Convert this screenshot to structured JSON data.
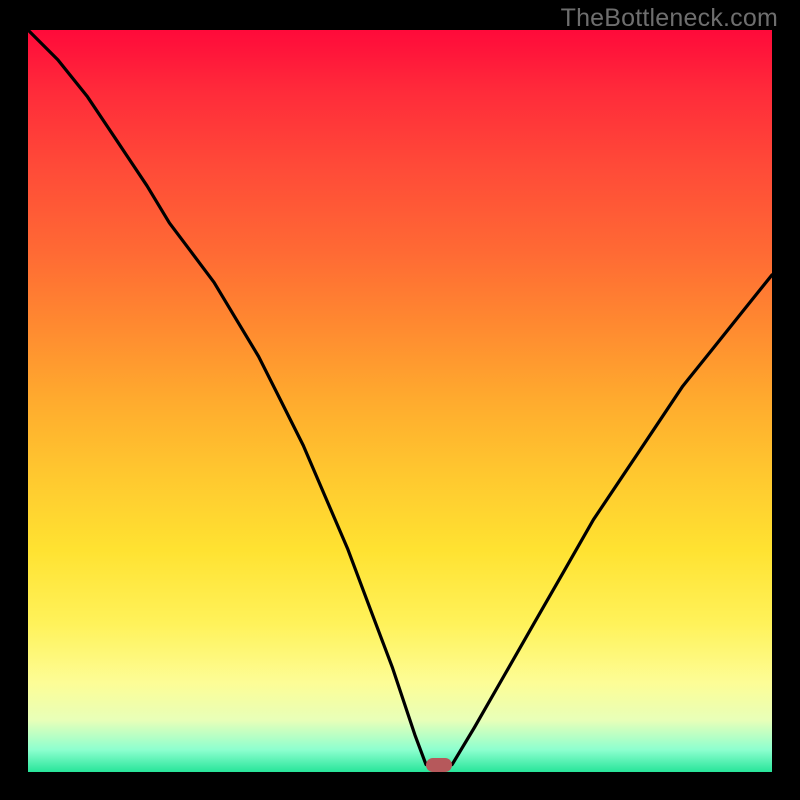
{
  "watermark": {
    "text": "TheBottleneck.com"
  },
  "marker": {
    "x_pct": 55.2,
    "y_pct": 99.05,
    "color": "#b6585b"
  },
  "chart_data": {
    "type": "line",
    "title": "",
    "xlabel": "",
    "ylabel": "",
    "xlim": [
      0,
      100
    ],
    "ylim": [
      0,
      100
    ],
    "grid": false,
    "legend": false,
    "series": [
      {
        "name": "bottleneck-curve-left",
        "x": [
          0,
          4,
          8,
          12,
          16,
          19,
          22,
          25,
          28,
          31,
          34,
          37,
          40,
          43,
          46,
          49,
          52,
          53.5
        ],
        "y": [
          100,
          96,
          91,
          85,
          79,
          74,
          70,
          66,
          61,
          56,
          50,
          44,
          37,
          30,
          22,
          14,
          5,
          1
        ]
      },
      {
        "name": "flat-bottom",
        "x": [
          53.5,
          57
        ],
        "y": [
          1,
          1
        ]
      },
      {
        "name": "bottleneck-curve-right",
        "x": [
          57,
          60,
          64,
          68,
          72,
          76,
          80,
          84,
          88,
          92,
          96,
          100
        ],
        "y": [
          1,
          6,
          13,
          20,
          27,
          34,
          40,
          46,
          52,
          57,
          62,
          67
        ]
      }
    ],
    "annotations": [
      {
        "text": "TheBottleneck.com",
        "pos": "top-right"
      }
    ],
    "background_gradient": {
      "stops": [
        {
          "pct": 0,
          "color": "#ff0a3a"
        },
        {
          "pct": 18,
          "color": "#ff4938"
        },
        {
          "pct": 40,
          "color": "#ff8a30"
        },
        {
          "pct": 60,
          "color": "#ffc82f"
        },
        {
          "pct": 80,
          "color": "#fff25a"
        },
        {
          "pct": 93,
          "color": "#e8ffb8"
        },
        {
          "pct": 100,
          "color": "#28e59a"
        }
      ]
    },
    "marker": {
      "x": 55.2,
      "y": 1,
      "color": "#b6585b",
      "shape": "pill"
    }
  }
}
